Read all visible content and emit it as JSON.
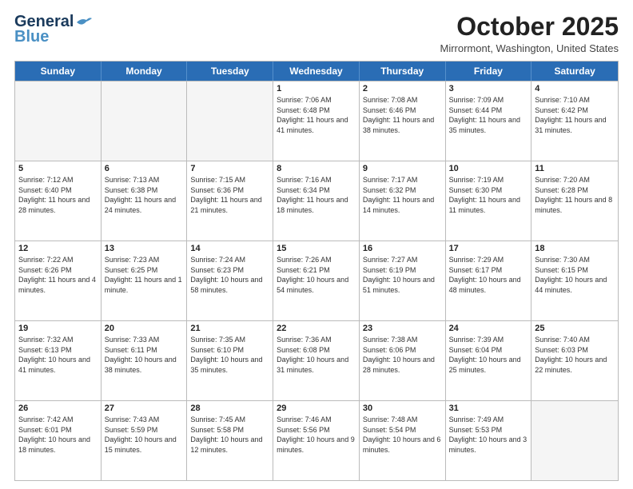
{
  "logo": {
    "line1": "General",
    "line2": "Blue"
  },
  "title": "October 2025",
  "location": "Mirrormont, Washington, United States",
  "days_of_week": [
    "Sunday",
    "Monday",
    "Tuesday",
    "Wednesday",
    "Thursday",
    "Friday",
    "Saturday"
  ],
  "weeks": [
    [
      {
        "day": "",
        "empty": true
      },
      {
        "day": "",
        "empty": true
      },
      {
        "day": "",
        "empty": true
      },
      {
        "day": "1",
        "sunrise": "7:06 AM",
        "sunset": "6:48 PM",
        "daylight": "11 hours and 41 minutes."
      },
      {
        "day": "2",
        "sunrise": "7:08 AM",
        "sunset": "6:46 PM",
        "daylight": "11 hours and 38 minutes."
      },
      {
        "day": "3",
        "sunrise": "7:09 AM",
        "sunset": "6:44 PM",
        "daylight": "11 hours and 35 minutes."
      },
      {
        "day": "4",
        "sunrise": "7:10 AM",
        "sunset": "6:42 PM",
        "daylight": "11 hours and 31 minutes."
      }
    ],
    [
      {
        "day": "5",
        "sunrise": "7:12 AM",
        "sunset": "6:40 PM",
        "daylight": "11 hours and 28 minutes."
      },
      {
        "day": "6",
        "sunrise": "7:13 AM",
        "sunset": "6:38 PM",
        "daylight": "11 hours and 24 minutes."
      },
      {
        "day": "7",
        "sunrise": "7:15 AM",
        "sunset": "6:36 PM",
        "daylight": "11 hours and 21 minutes."
      },
      {
        "day": "8",
        "sunrise": "7:16 AM",
        "sunset": "6:34 PM",
        "daylight": "11 hours and 18 minutes."
      },
      {
        "day": "9",
        "sunrise": "7:17 AM",
        "sunset": "6:32 PM",
        "daylight": "11 hours and 14 minutes."
      },
      {
        "day": "10",
        "sunrise": "7:19 AM",
        "sunset": "6:30 PM",
        "daylight": "11 hours and 11 minutes."
      },
      {
        "day": "11",
        "sunrise": "7:20 AM",
        "sunset": "6:28 PM",
        "daylight": "11 hours and 8 minutes."
      }
    ],
    [
      {
        "day": "12",
        "sunrise": "7:22 AM",
        "sunset": "6:26 PM",
        "daylight": "11 hours and 4 minutes."
      },
      {
        "day": "13",
        "sunrise": "7:23 AM",
        "sunset": "6:25 PM",
        "daylight": "11 hours and 1 minute."
      },
      {
        "day": "14",
        "sunrise": "7:24 AM",
        "sunset": "6:23 PM",
        "daylight": "10 hours and 58 minutes."
      },
      {
        "day": "15",
        "sunrise": "7:26 AM",
        "sunset": "6:21 PM",
        "daylight": "10 hours and 54 minutes."
      },
      {
        "day": "16",
        "sunrise": "7:27 AM",
        "sunset": "6:19 PM",
        "daylight": "10 hours and 51 minutes."
      },
      {
        "day": "17",
        "sunrise": "7:29 AM",
        "sunset": "6:17 PM",
        "daylight": "10 hours and 48 minutes."
      },
      {
        "day": "18",
        "sunrise": "7:30 AM",
        "sunset": "6:15 PM",
        "daylight": "10 hours and 44 minutes."
      }
    ],
    [
      {
        "day": "19",
        "sunrise": "7:32 AM",
        "sunset": "6:13 PM",
        "daylight": "10 hours and 41 minutes."
      },
      {
        "day": "20",
        "sunrise": "7:33 AM",
        "sunset": "6:11 PM",
        "daylight": "10 hours and 38 minutes."
      },
      {
        "day": "21",
        "sunrise": "7:35 AM",
        "sunset": "6:10 PM",
        "daylight": "10 hours and 35 minutes."
      },
      {
        "day": "22",
        "sunrise": "7:36 AM",
        "sunset": "6:08 PM",
        "daylight": "10 hours and 31 minutes."
      },
      {
        "day": "23",
        "sunrise": "7:38 AM",
        "sunset": "6:06 PM",
        "daylight": "10 hours and 28 minutes."
      },
      {
        "day": "24",
        "sunrise": "7:39 AM",
        "sunset": "6:04 PM",
        "daylight": "10 hours and 25 minutes."
      },
      {
        "day": "25",
        "sunrise": "7:40 AM",
        "sunset": "6:03 PM",
        "daylight": "10 hours and 22 minutes."
      }
    ],
    [
      {
        "day": "26",
        "sunrise": "7:42 AM",
        "sunset": "6:01 PM",
        "daylight": "10 hours and 18 minutes."
      },
      {
        "day": "27",
        "sunrise": "7:43 AM",
        "sunset": "5:59 PM",
        "daylight": "10 hours and 15 minutes."
      },
      {
        "day": "28",
        "sunrise": "7:45 AM",
        "sunset": "5:58 PM",
        "daylight": "10 hours and 12 minutes."
      },
      {
        "day": "29",
        "sunrise": "7:46 AM",
        "sunset": "5:56 PM",
        "daylight": "10 hours and 9 minutes."
      },
      {
        "day": "30",
        "sunrise": "7:48 AM",
        "sunset": "5:54 PM",
        "daylight": "10 hours and 6 minutes."
      },
      {
        "day": "31",
        "sunrise": "7:49 AM",
        "sunset": "5:53 PM",
        "daylight": "10 hours and 3 minutes."
      },
      {
        "day": "",
        "empty": true
      }
    ]
  ]
}
